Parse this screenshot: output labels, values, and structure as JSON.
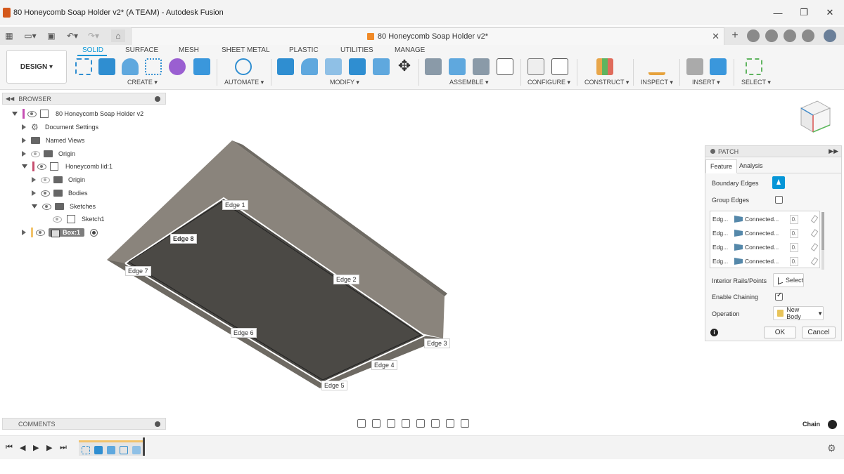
{
  "window": {
    "title": "80 Honeycomb Soap Holder v2* (A TEAM) - Autodesk Fusion",
    "minimize": "—",
    "maximize": "❐",
    "close": "✕"
  },
  "tabbar": {
    "doc_tab_title": "80 Honeycomb Soap Holder v2*",
    "close": "✕",
    "add": "+"
  },
  "ribbon": {
    "workspace": "DESIGN ▾",
    "tabs": [
      "SOLID",
      "SURFACE",
      "MESH",
      "SHEET METAL",
      "PLASTIC",
      "UTILITIES",
      "MANAGE"
    ],
    "groups": [
      "CREATE ▾",
      "AUTOMATE ▾",
      "MODIFY ▾",
      "ASSEMBLE ▾",
      "CONFIGURE ▾",
      "CONSTRUCT ▾",
      "INSPECT ▾",
      "INSERT ▾",
      "SELECT ▾"
    ]
  },
  "browser": {
    "title": "BROWSER",
    "items": [
      {
        "label": "80 Honeycomb Soap Holder v2"
      },
      {
        "label": "Document Settings"
      },
      {
        "label": "Named Views"
      },
      {
        "label": "Origin"
      },
      {
        "label": "Honeycomb lid:1"
      },
      {
        "label": "Origin"
      },
      {
        "label": "Bodies"
      },
      {
        "label": "Sketches"
      },
      {
        "label": "Sketch1"
      },
      {
        "label": "Box:1"
      }
    ]
  },
  "model": {
    "edge_labels": [
      "Edge 1",
      "Edge 8",
      "Edge 7",
      "Edge 2",
      "Edge 6",
      "Edge 3",
      "Edge 4",
      "Edge 5"
    ],
    "colors": {
      "top": "#8a847c",
      "wall": "#6e6a63",
      "inner": "#4b4945",
      "edge": "#ffffff"
    }
  },
  "patch": {
    "title": "PATCH",
    "tabs": [
      "Feature",
      "Analysis"
    ],
    "boundary_edges": "Boundary Edges",
    "group_edges": "Group Edges",
    "edge_rows": [
      {
        "name": "Edg...",
        "type": "Connected...",
        "value": "0."
      },
      {
        "name": "Edg...",
        "type": "Connected...",
        "value": "0."
      },
      {
        "name": "Edg...",
        "type": "Connected...",
        "value": "0."
      },
      {
        "name": "Edg...",
        "type": "Connected...",
        "value": "0."
      }
    ],
    "interior_rails": "Interior Rails/Points",
    "select_btn": "Select",
    "enable_chaining": "Enable Chaining",
    "operation": "Operation",
    "operation_value": "New Body",
    "ok": "OK",
    "cancel": "Cancel"
  },
  "comments": {
    "title": "COMMENTS"
  },
  "status": {
    "chain": "Chain"
  },
  "timeline": {
    "controls": [
      "⏮",
      "◀",
      "▶",
      "▶",
      "⏭"
    ],
    "settings": "⚙"
  }
}
